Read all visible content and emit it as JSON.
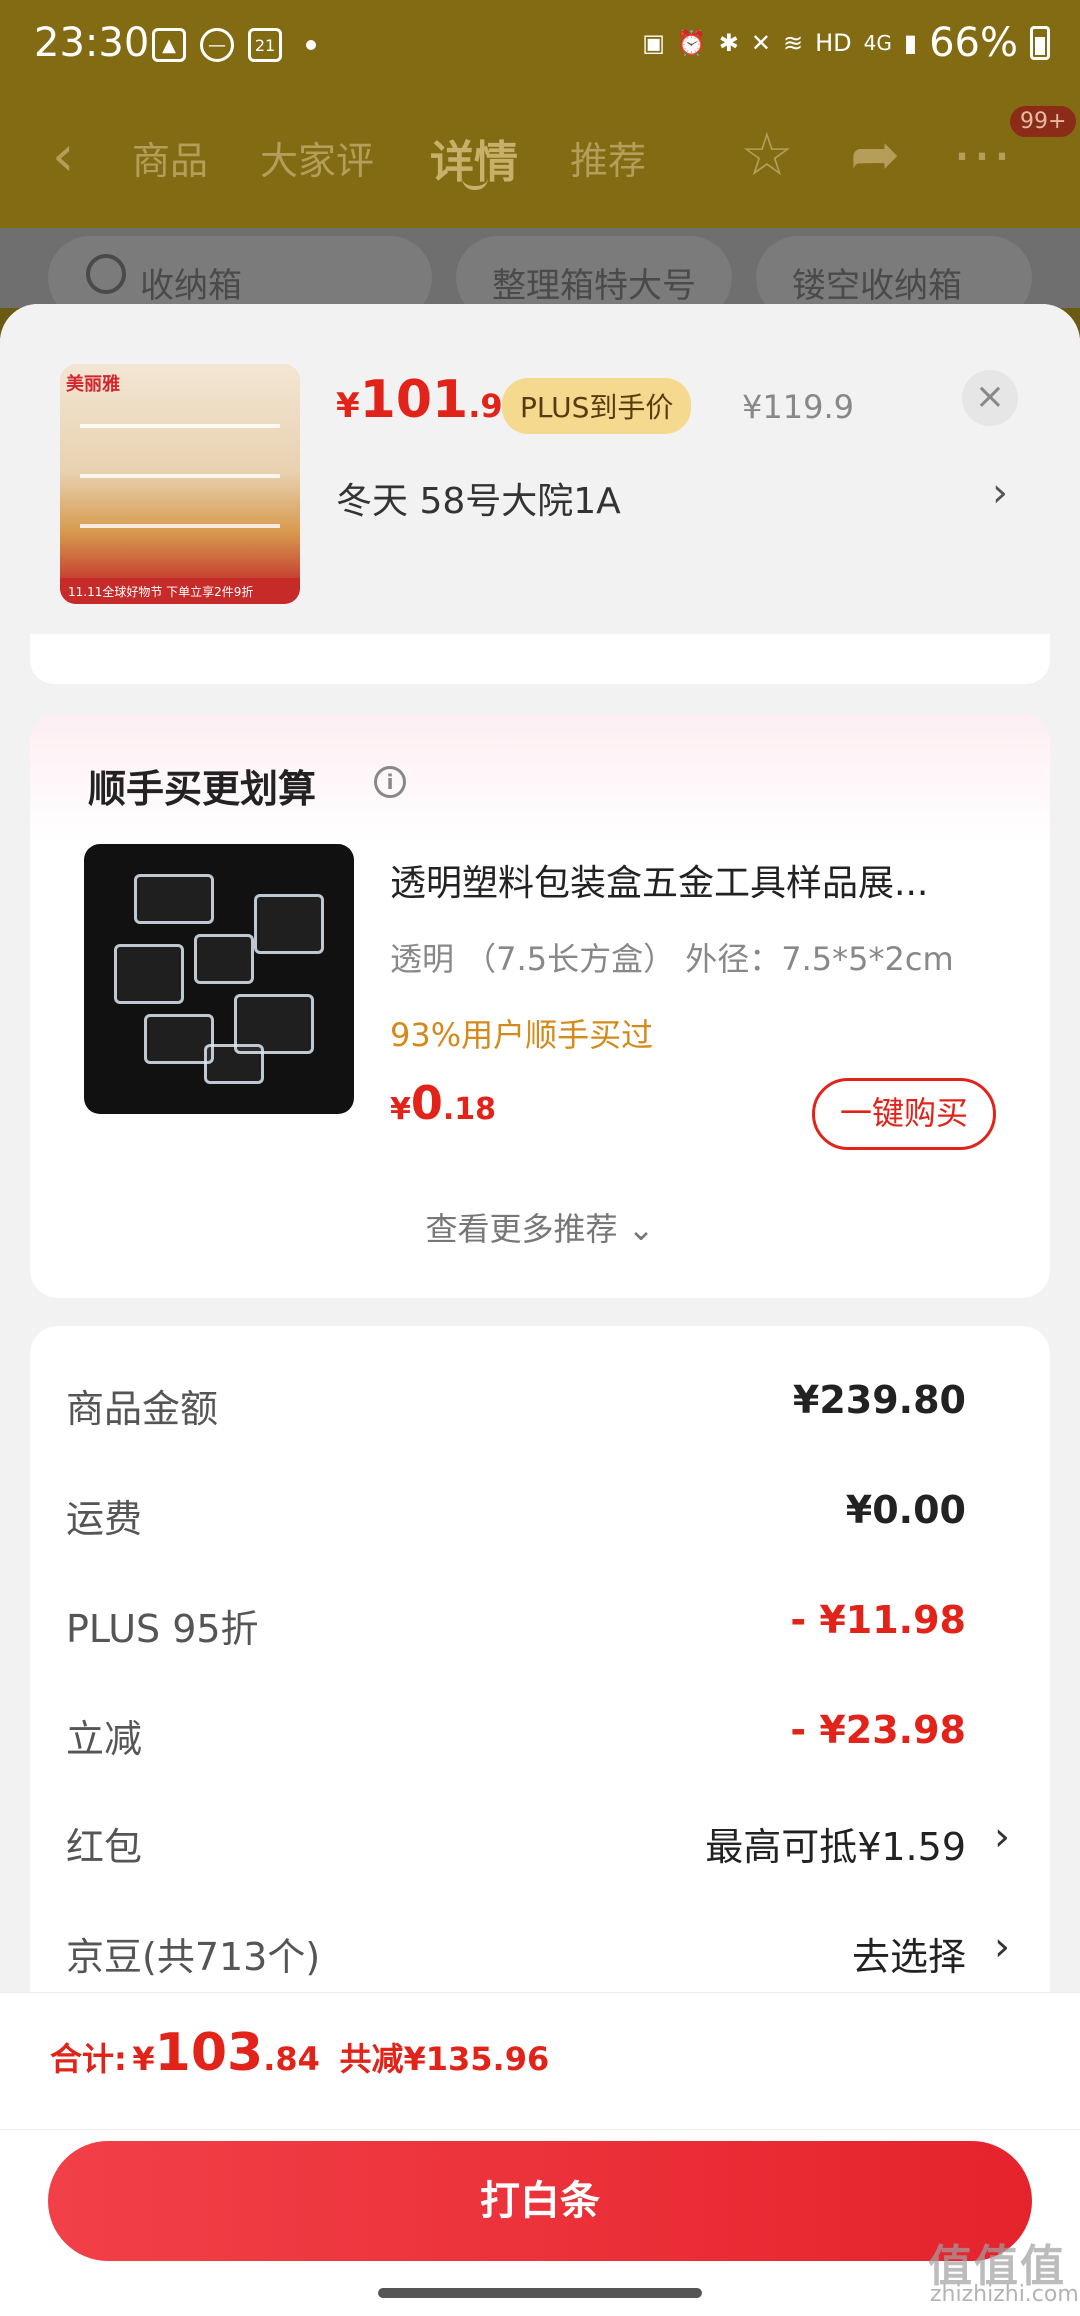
{
  "status_bar": {
    "time": "23:30",
    "calendar_day": "21",
    "network_label": "HD",
    "network_gen": "4G",
    "battery_pct": "66%"
  },
  "nav": {
    "tabs": [
      "商品",
      "大家评",
      "详情",
      "推荐"
    ],
    "active_tab": "详情",
    "badge": "99+"
  },
  "search_chips": [
    "收纳箱",
    "整理箱特大号",
    "镂空收纳箱"
  ],
  "sheet": {
    "thumb_brand": "美丽雅",
    "thumb_promo": "11.11全球好物节  下单立享2件9折",
    "price_yen": "¥",
    "price_int": "101",
    "price_dec": ".92",
    "plus_tag": "PLUS到手价",
    "price_original": "¥119.9",
    "close_label": "×",
    "address": "冬天  58号大院1A"
  },
  "recommend": {
    "title": "顺手买更划算",
    "info_icon": "i",
    "item_name": "透明塑料包装盒五金工具样品展...",
    "item_spec": "透明  （7.5长方盒） 外径：7.5*5*2cm",
    "item_tip": "93%用户顺手买过",
    "price_yen": "¥",
    "price_int": "0",
    "price_dec": ".18",
    "buy_button": "一键购买",
    "more_link": "查看更多推荐 ⌄"
  },
  "fees": [
    {
      "label": "商品金额",
      "value": "¥239.80"
    },
    {
      "label": "运费",
      "value": "¥0.00"
    },
    {
      "label": "PLUS 95折",
      "value": "- ¥11.98"
    },
    {
      "label": "立减",
      "value": "- ¥23.98"
    },
    {
      "label": "红包",
      "value": "最高可抵¥1.59"
    },
    {
      "label": "京豆(共713个)",
      "value": "去选择"
    }
  ],
  "footer": {
    "total_label": "合计:",
    "total_yen": "¥",
    "total_int": "103",
    "total_dec": ".84",
    "total_saved": "共减¥135.96",
    "pay_button": "打白条"
  },
  "watermark": {
    "main": "值值值",
    "sub": "zhizhizhi.com"
  },
  "colors": {
    "accent_red": "#e2231a",
    "plus_gold": "#f5d98f",
    "tip_orange": "#d48a1a"
  }
}
